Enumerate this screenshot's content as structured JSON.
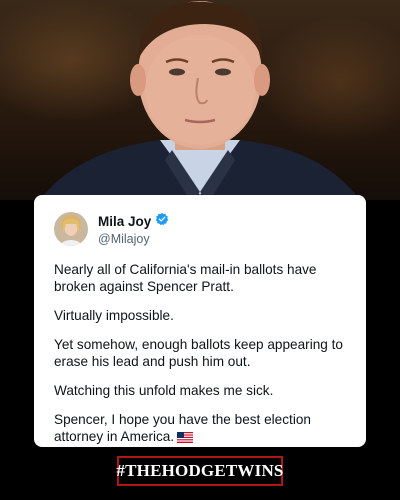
{
  "photo": {
    "description_icon": "person-photo"
  },
  "tweet": {
    "display_name": "Mila Joy",
    "handle": "@Milajoy",
    "verified_icon": "verified-badge-icon",
    "paragraphs": [
      "Nearly all of California's mail-in ballots have broken against Spencer Pratt.",
      "Virtually impossible.",
      "Yet somehow, enough ballots keep appearing to erase his lead and push him out.",
      "Watching this unfold makes me sick.",
      "Spencer, I hope you have the best election attorney in America."
    ],
    "flag_icon": "us-flag-emoji"
  },
  "footer": {
    "hashtag": "#THEHODGETWINS"
  },
  "colors": {
    "verified": "#1d9bf0",
    "hashtag_border": "#b01818",
    "card_bg": "#ffffff"
  }
}
